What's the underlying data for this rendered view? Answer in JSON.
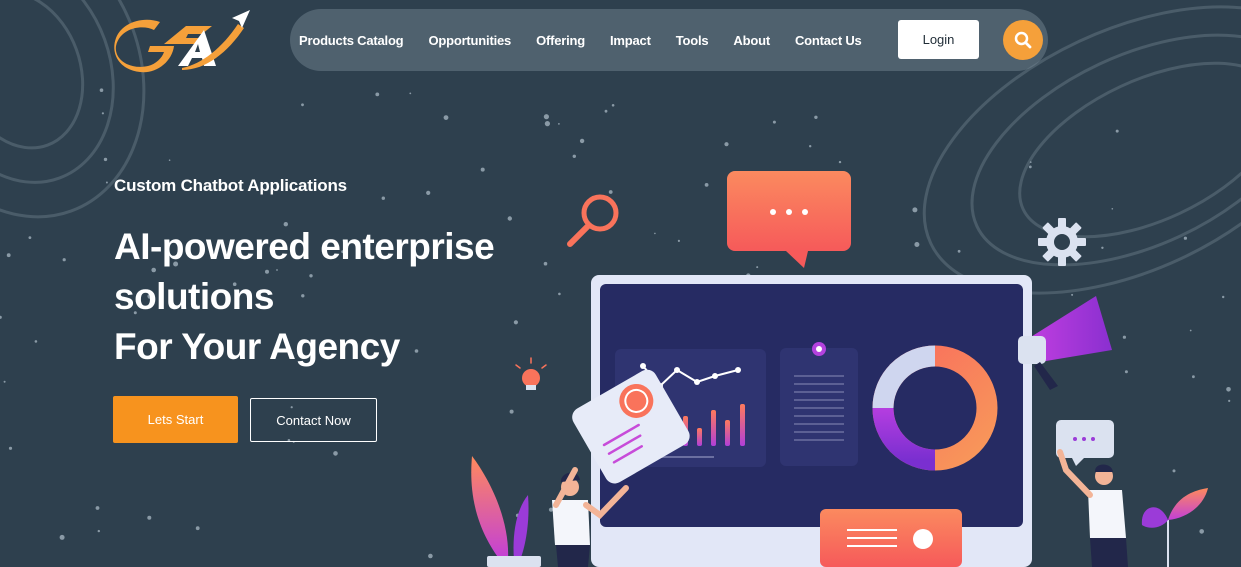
{
  "brand": {
    "logo_text": "GFA"
  },
  "nav": {
    "items": [
      {
        "label": "Products Catalog"
      },
      {
        "label": "Opportunities"
      },
      {
        "label": "Offering"
      },
      {
        "label": "Impact"
      },
      {
        "label": "Tools"
      },
      {
        "label": "About"
      },
      {
        "label": "Contact Us"
      }
    ],
    "login_label": "Login",
    "search_icon": "search-icon"
  },
  "hero": {
    "eyebrow": "Custom Chatbot Applications",
    "headline_lines": [
      "AI-powered enterprise",
      "solutions",
      "For Your Agency"
    ],
    "primary_cta": "Lets Start",
    "secondary_cta": "Contact Now"
  },
  "colors": {
    "background": "#2e404e",
    "accent_orange": "#f7931e",
    "accent_coral": "#f9735b",
    "accent_purple": "#9b3bd8",
    "monitor_screen": "#262b63"
  }
}
